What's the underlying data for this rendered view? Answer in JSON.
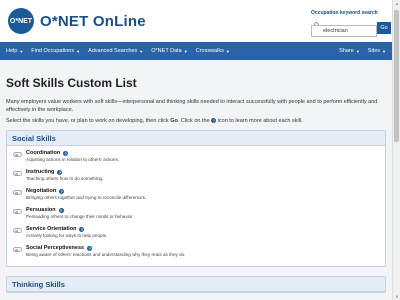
{
  "header": {
    "logo_mark": "O*NET",
    "logo_text": "O*NET OnLine",
    "search_label": "Occupation keyword search",
    "search_value": "electrician",
    "go_label": "Go"
  },
  "nav": {
    "left": [
      "Help",
      "Find Occupations",
      "Advanced Searches",
      "O*NET Data",
      "Crosswalks"
    ],
    "right": [
      "Share",
      "Sites"
    ]
  },
  "page": {
    "title": "Soft Skills Custom List",
    "intro": "Many employers value workers with soft skills—interpersonal and thinking skills needed to interact successfully with people and to perform efficiently and effectively in the workplace.",
    "instr_before": "Select the skills you have, or plan to work on developing, then click ",
    "instr_go": "Go",
    "instr_mid": ". Click on the ",
    "instr_after": " icon to learn more about each skill."
  },
  "sections": [
    {
      "title": "Social Skills",
      "skills": [
        {
          "name": "Coordination",
          "desc": "Adjusting actions in relation to others' actions."
        },
        {
          "name": "Instructing",
          "desc": "Teaching others how to do something."
        },
        {
          "name": "Negotiation",
          "desc": "Bringing others together and trying to reconcile differences."
        },
        {
          "name": "Persuasion",
          "desc": "Persuading others to change their minds or behavior."
        },
        {
          "name": "Service Orientation",
          "desc": "Actively looking for ways to help people."
        },
        {
          "name": "Social Perceptiveness",
          "desc": "Being aware of others' reactions and understanding why they react as they do."
        }
      ]
    },
    {
      "title": "Thinking Skills",
      "skills": []
    }
  ],
  "icons": {
    "info": "question-circle-icon",
    "search": "search-icon"
  },
  "colors": {
    "brand": "#1d5a99",
    "nav": "#2a64a8",
    "section_header": "#e4ecf6"
  }
}
